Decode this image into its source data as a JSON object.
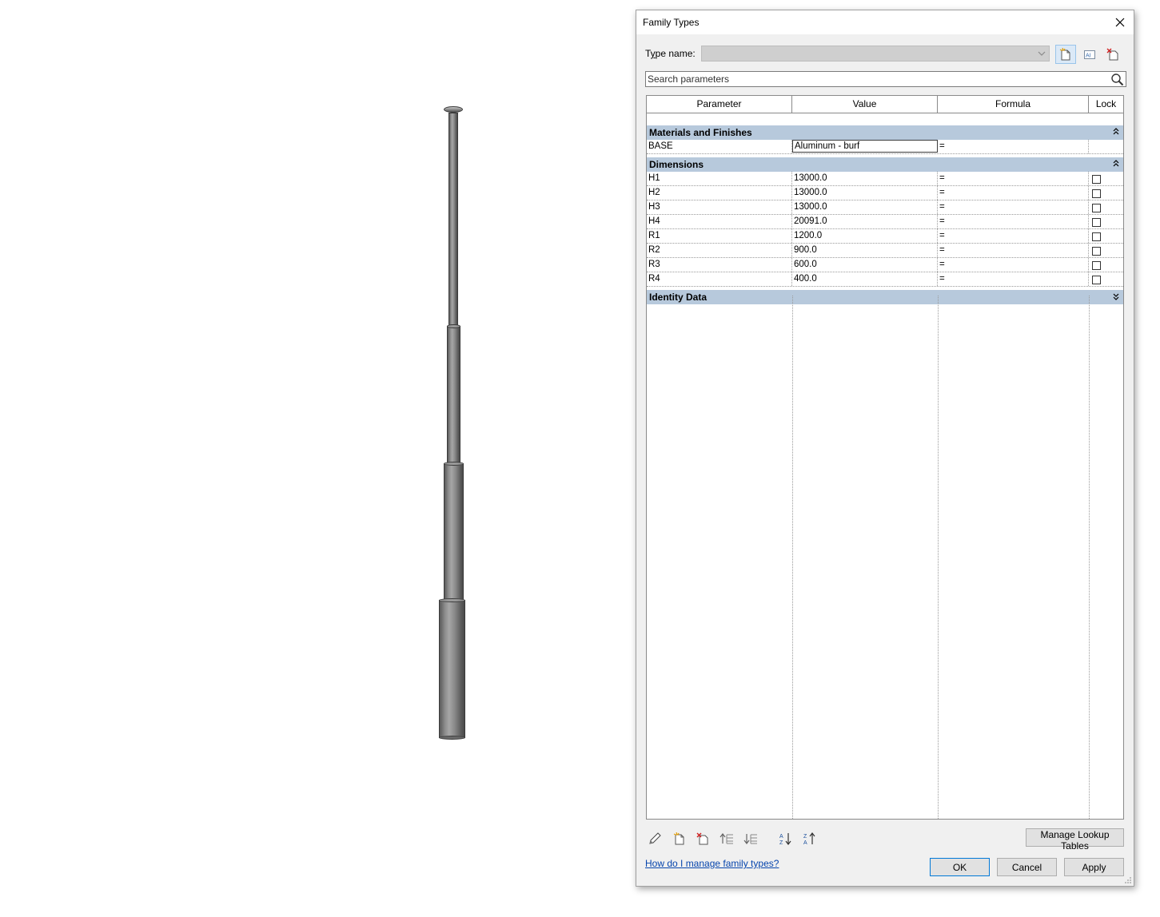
{
  "dialog": {
    "title": "Family Types",
    "type_name_label": "Type name:",
    "type_name_value": "",
    "search_placeholder": "Search parameters"
  },
  "grid": {
    "headers": [
      "Parameter",
      "Value",
      "Formula",
      "Lock"
    ],
    "groups": [
      {
        "name": "Materials and Finishes",
        "expanded": true,
        "rows": [
          {
            "parameter": "BASE",
            "value": "Aluminum - burf",
            "formula": "=",
            "lock": null
          }
        ]
      },
      {
        "name": "Dimensions",
        "expanded": true,
        "rows": [
          {
            "parameter": "H1",
            "value": "13000.0",
            "formula": "=",
            "lock": false
          },
          {
            "parameter": "H2",
            "value": "13000.0",
            "formula": "=",
            "lock": false
          },
          {
            "parameter": "H3",
            "value": "13000.0",
            "formula": "=",
            "lock": false
          },
          {
            "parameter": "H4",
            "value": "20091.0",
            "formula": "=",
            "lock": false
          },
          {
            "parameter": "R1",
            "value": "1200.0",
            "formula": "=",
            "lock": false
          },
          {
            "parameter": "R2",
            "value": "900.0",
            "formula": "=",
            "lock": false
          },
          {
            "parameter": "R3",
            "value": "600.0",
            "formula": "=",
            "lock": false
          },
          {
            "parameter": "R4",
            "value": "400.0",
            "formula": "=",
            "lock": false
          }
        ]
      },
      {
        "name": "Identity Data",
        "expanded": false,
        "rows": []
      }
    ]
  },
  "toolbar_icons": [
    "edit-parameter-icon",
    "new-parameter-icon",
    "delete-parameter-icon",
    "move-up-icon",
    "move-down-icon",
    "sort-ascending-icon",
    "sort-descending-icon"
  ],
  "buttons": {
    "manage_lookup": "Manage Lookup Tables",
    "help_link": "How do I manage family types?",
    "ok": "OK",
    "cancel": "Cancel",
    "apply": "Apply"
  },
  "colors": {
    "group_header": "#b7c9dc",
    "dialog_bg": "#f0f0f0",
    "link": "#0645ad"
  }
}
